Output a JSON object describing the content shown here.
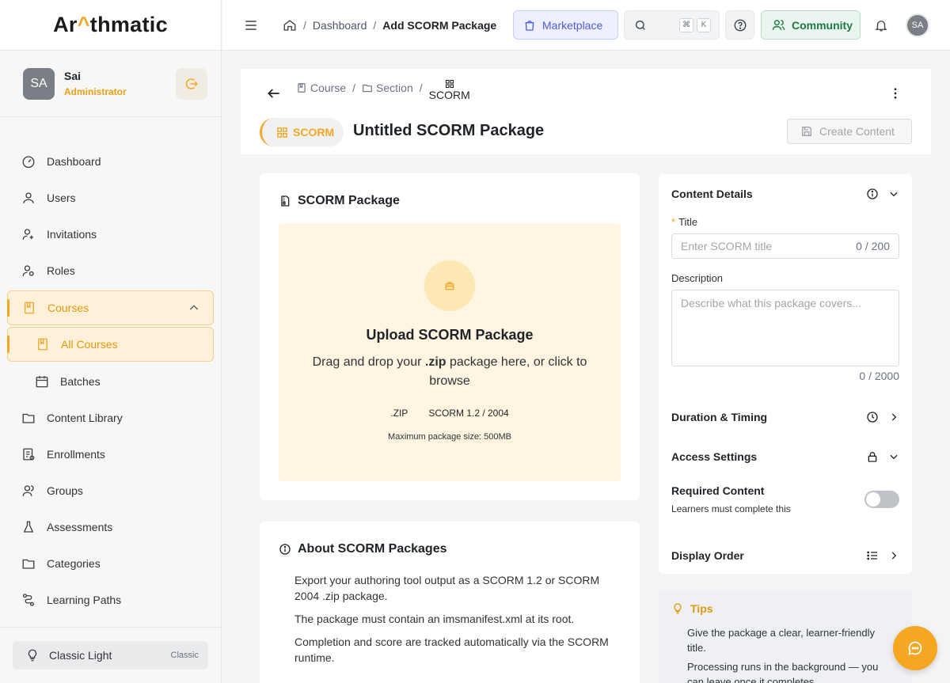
{
  "app": {
    "logo_text_pre": "Ar",
    "logo_text_acc": "^",
    "logo_text_post": "thmatic"
  },
  "user": {
    "initials": "SA",
    "name": "Sai",
    "role": "Administrator"
  },
  "sidebar": {
    "items": [
      {
        "label": "Dashboard",
        "icon": "dashboard-icon"
      },
      {
        "label": "Users",
        "icon": "user-icon"
      },
      {
        "label": "Invitations",
        "icon": "invite-icon"
      },
      {
        "label": "Roles",
        "icon": "roles-icon"
      },
      {
        "label": "Courses",
        "icon": "book-icon",
        "active": true,
        "expanded": true
      },
      {
        "label": "All Courses",
        "icon": "book-icon",
        "active": true,
        "sub": true
      },
      {
        "label": "Batches",
        "icon": "calendar-icon",
        "sub": true
      },
      {
        "label": "Content Library",
        "icon": "folder-icon"
      },
      {
        "label": "Enrollments",
        "icon": "enrollment-icon"
      },
      {
        "label": "Groups",
        "icon": "groups-icon"
      },
      {
        "label": "Assessments",
        "icon": "flask-icon"
      },
      {
        "label": "Categories",
        "icon": "folder-icon"
      },
      {
        "label": "Learning Paths",
        "icon": "path-icon"
      }
    ],
    "theme": {
      "label": "Classic Light",
      "tag": "Classic"
    }
  },
  "topbar": {
    "breadcrumb": [
      "Dashboard",
      "Add SCORM Package"
    ],
    "marketplace_label": "Marketplace",
    "search_keys": [
      "⌘",
      "K"
    ],
    "community_label": "Community",
    "avatar_initials": "SA"
  },
  "header": {
    "breadcrumb": [
      "Course",
      "Section",
      "SCORM"
    ],
    "type_pill": "SCORM",
    "title": "Untitled SCORM Package",
    "create_label": "Create Content"
  },
  "upload": {
    "card_title": "SCORM Package",
    "title": "Upload SCORM Package",
    "text_pre": "Drag and drop your ",
    "text_bold": ".zip",
    "text_post": " package here, or click to browse",
    "formats": [
      ".ZIP",
      "SCORM 1.2 / 2004"
    ],
    "max_size": "Maximum package size: 500MB"
  },
  "about": {
    "title": "About SCORM Packages",
    "items": [
      "Export your authoring tool output as a SCORM 1.2 or SCORM 2004 .zip package.",
      "The package must contain an imsmanifest.xml at its root.",
      "Completion and score are tracked automatically via the SCORM runtime."
    ]
  },
  "details": {
    "title": "Content Details",
    "title_label": "Title",
    "title_placeholder": "Enter SCORM title",
    "title_count": "0 / 200",
    "description_label": "Description",
    "description_placeholder": "Describe what this package covers...",
    "description_count": "0 / 2000",
    "duration_label": "Duration & Timing",
    "access_label": "Access Settings",
    "required_label": "Required Content",
    "required_sub": "Learners must complete this",
    "required_on": false,
    "display_order_label": "Display Order"
  },
  "tips": {
    "title": "Tips",
    "items": [
      "Give the package a clear, learner-friendly title.",
      "Processing runs in the background — you can leave once it completes."
    ]
  },
  "colors": {
    "accent": "#f5a623",
    "marketplace": "#4f5bd5",
    "community": "#1e7a45"
  }
}
